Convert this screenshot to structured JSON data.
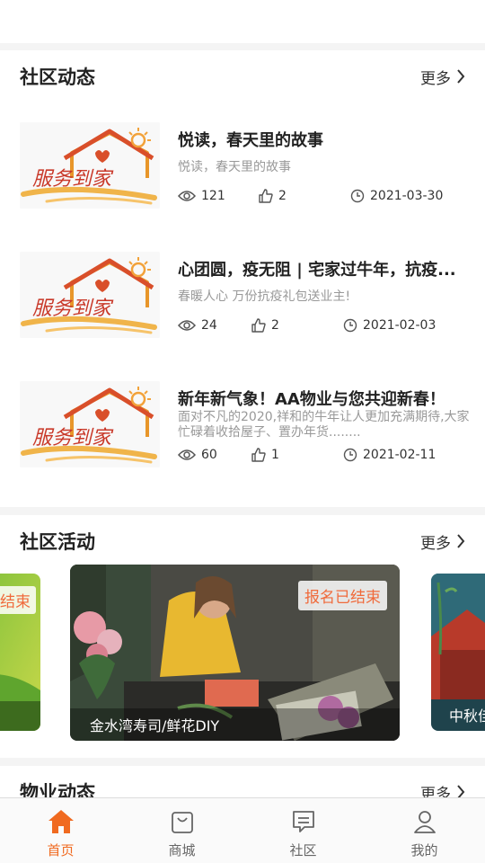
{
  "news": {
    "title": "社区动态",
    "more": "更多",
    "items": [
      {
        "title": "悦读，春天里的故事",
        "summary": "悦读，春天里的故事",
        "views": "121",
        "likes": "2",
        "date": "2021-03-30",
        "image_text": "服务到家"
      },
      {
        "title": "心团圆，疫无阻 | 宅家过牛年，抗疫...",
        "summary": "春暖人心  万份抗疫礼包送业主!",
        "views": "24",
        "likes": "2",
        "date": "2021-02-03",
        "image_text": "服务到家"
      },
      {
        "title": "新年新气象！AA物业与您共迎新春！",
        "summary": "面对不凡的2020,祥和的牛年让人更加充满期待,大家忙碌着收拾屋子、置办年货........",
        "views": "60",
        "likes": "1",
        "date": "2021-02-11",
        "image_text": "服务到家"
      }
    ]
  },
  "activities": {
    "title": "社区活动",
    "more": "更多",
    "cards": [
      {
        "status": "结束",
        "caption": ""
      },
      {
        "status": "报名已结束",
        "caption": "金水湾寿司/鲜花DIY"
      },
      {
        "status": "",
        "caption": "中秋佳"
      }
    ]
  },
  "property": {
    "title": "物业动态",
    "more": "更多"
  },
  "tabbar": {
    "items": [
      {
        "label": "首页",
        "icon": "home-icon",
        "active": true
      },
      {
        "label": "商城",
        "icon": "shopping-bag-icon",
        "active": false
      },
      {
        "label": "社区",
        "icon": "chat-icon",
        "active": false
      },
      {
        "label": "我的",
        "icon": "user-icon",
        "active": false
      }
    ]
  },
  "colors": {
    "accent": "#f06a20",
    "badge_text": "#f06a3b",
    "background": "#f4f4f4"
  }
}
